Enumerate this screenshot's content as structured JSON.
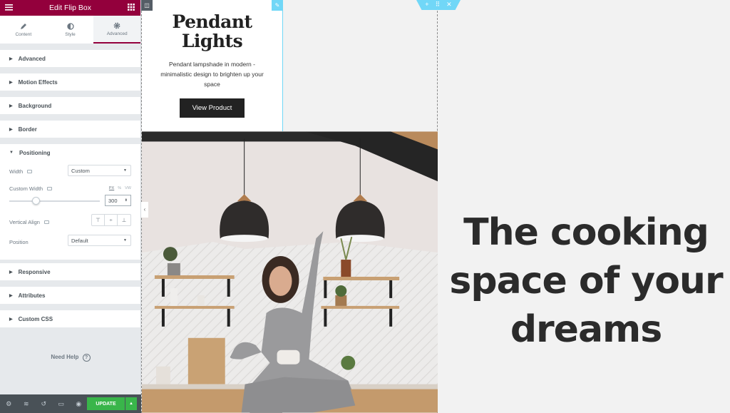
{
  "panel": {
    "title": "Edit Flip Box",
    "tabs": [
      {
        "label": "Content",
        "icon": "pencil-icon"
      },
      {
        "label": "Style",
        "icon": "contrast-icon"
      },
      {
        "label": "Advanced",
        "icon": "gear-icon",
        "active": true
      }
    ],
    "sections_top": [
      "Advanced",
      "Motion Effects",
      "Background",
      "Border",
      "Positioning"
    ],
    "positioning": {
      "width_label": "Width",
      "width_value": "Custom",
      "custom_width_label": "Custom Width",
      "units": [
        "PX",
        "%",
        "VW"
      ],
      "custom_width_value": "300",
      "slider_percent": 20,
      "vertical_align_label": "Vertical Align",
      "position_label": "Position",
      "position_value": "Default"
    },
    "sections_bottom": [
      "Responsive",
      "Attributes",
      "Custom CSS"
    ],
    "need_help": "Need Help",
    "update_label": "UPDATE",
    "accent": "#93003c",
    "update_color": "#39b54a"
  },
  "flipbox": {
    "title_line1": "Pendant",
    "title_line2": "Lights",
    "description": "Pendant lampshade in modern - minimalistic design to brighten up your space",
    "button": "View Product"
  },
  "hero": {
    "line1": "The cooking",
    "line2": "space of your",
    "line3": "dreams"
  }
}
